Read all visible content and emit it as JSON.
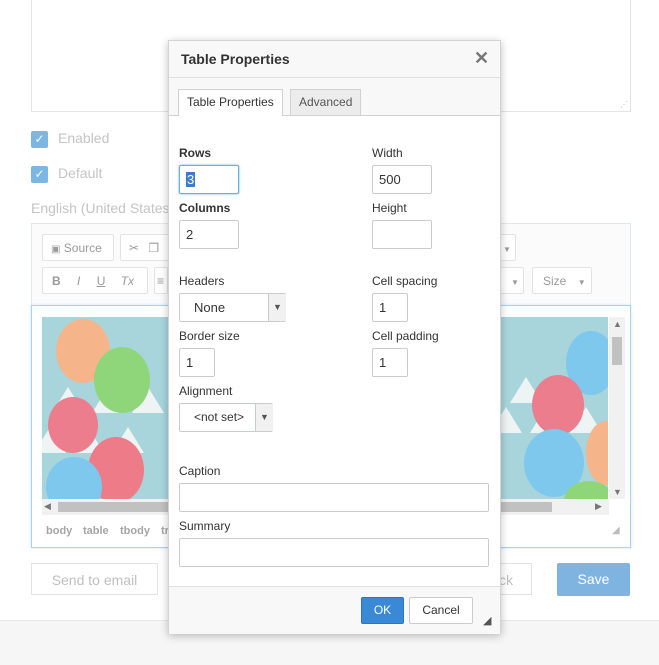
{
  "background": {
    "enabled_label": "Enabled",
    "default_label": "Default",
    "language_label": "English (United States",
    "toolbar": {
      "source_label": "Source",
      "size_label": "Size",
      "bold_label": "B",
      "italic_label": "I",
      "underline_label": "U",
      "clear_format_label": "Tx"
    },
    "element_path": [
      "body",
      "table",
      "tbody",
      "tr"
    ],
    "send_email_label": "Send to email",
    "back_label": "ck",
    "save_label": "Save"
  },
  "dialog": {
    "title": "Table Properties",
    "close_glyph": "✕",
    "tabs": [
      {
        "label": "Table Properties",
        "active": true
      },
      {
        "label": "Advanced",
        "active": false
      }
    ],
    "fields": {
      "rows": {
        "label": "Rows",
        "value": "3"
      },
      "columns": {
        "label": "Columns",
        "value": "2"
      },
      "width": {
        "label": "Width",
        "value": "500"
      },
      "height": {
        "label": "Height",
        "value": ""
      },
      "headers": {
        "label": "Headers",
        "value": "None"
      },
      "cell_spacing": {
        "label": "Cell spacing",
        "value": "1"
      },
      "border_size": {
        "label": "Border size",
        "value": "1"
      },
      "cell_padding": {
        "label": "Cell padding",
        "value": "1"
      },
      "alignment": {
        "label": "Alignment",
        "value": "<not set>"
      },
      "caption": {
        "label": "Caption",
        "value": ""
      },
      "summary": {
        "label": "Summary",
        "value": ""
      }
    },
    "ok_label": "OK",
    "cancel_label": "Cancel"
  },
  "colors": {
    "accent": "#3a89d6",
    "checkbox": "#7cb7e4",
    "save_button": "#7fb3e0"
  }
}
